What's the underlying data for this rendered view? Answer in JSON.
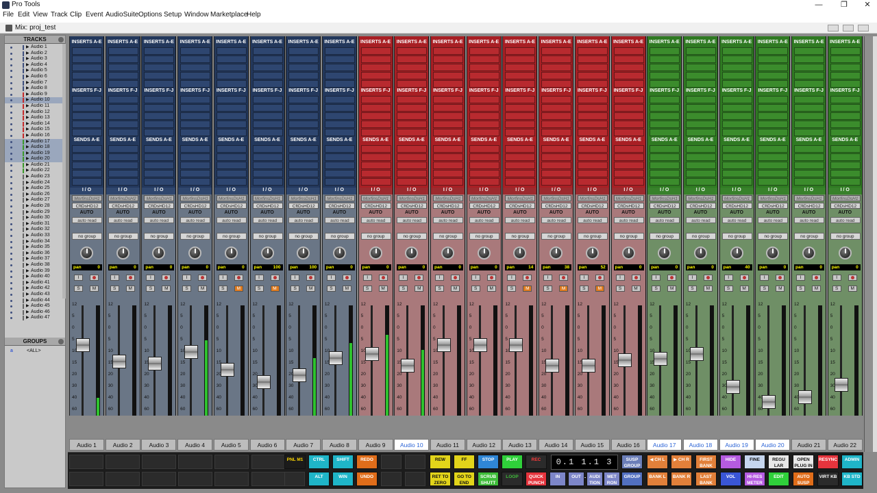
{
  "window": {
    "app_title": "Pro Tools",
    "minimize": "—",
    "restore": "❐",
    "close": "✕"
  },
  "menu": [
    "File",
    "Edit",
    "View",
    "Track",
    "Clip",
    "Event",
    "AudioSuite",
    "Options",
    "Setup",
    "Window",
    "Marketplace",
    "Help"
  ],
  "doc": {
    "title": "Mix: proj_test"
  },
  "tracks_pane": {
    "title": "TRACKS",
    "items": [
      "Audio 1",
      "Audio 2",
      "Audio 3",
      "Audio 4",
      "Audio 5",
      "Audio 6",
      "Audio 7",
      "Audio 8",
      "Audio 9",
      "Audio 10",
      "Audio 11",
      "Audio 12",
      "Audio 13",
      "Audio 14",
      "Audio 15",
      "Audio 16",
      "Audio 17",
      "Audio 18",
      "Audio 19",
      "Audio 20",
      "Audio 21",
      "Audio 22",
      "Audio 23",
      "Audio 24",
      "Audio 25",
      "Audio 26",
      "Audio 27",
      "Audio 28",
      "Audio 29",
      "Audio 30",
      "Audio 31",
      "Audio 32",
      "Audio 33",
      "Audio 34",
      "Audio 35",
      "Audio 36",
      "Audio 37",
      "Audio 38",
      "Audio 39",
      "Audio 40",
      "Audio 41",
      "Audio 42",
      "Audio 43",
      "Audio 44",
      "Audio 45",
      "Audio 46",
      "Audio 47"
    ],
    "selected": [
      10,
      17,
      18,
      19,
      20
    ]
  },
  "groups_pane": {
    "title": "GROUPS",
    "id": "a",
    "all": "<ALL>"
  },
  "strip_labels": {
    "inserts_ae": "INSERTS A-E",
    "inserts_fj": "INSERTS F-J",
    "sends": "SENDS A-E",
    "io": "I / O",
    "auto": "AUTO",
    "auto_mode": "auto read",
    "group": "no group",
    "pan": "pan",
    "solo": "S",
    "mute": "M",
    "input": "I",
    "link": "L"
  },
  "channels": [
    {
      "name": "Audio 1",
      "color": "blue",
      "in1": "MorfinsDsH1",
      "in2": "CftDsHD12",
      "pan": "0",
      "vol": "0.0",
      "vnum": "",
      "mute_on": false,
      "fader": 0.66,
      "meter": 0.2,
      "name_hi": false
    },
    {
      "name": "Audio 2",
      "color": "blue",
      "in1": "MorfinsDsH2",
      "in2": "CftDsHD12",
      "pan": "0",
      "vol": "-6.9",
      "vnum": "",
      "mute_on": false,
      "fader": 0.52,
      "meter": 0,
      "name_hi": false
    },
    {
      "name": "Audio 3",
      "color": "blue",
      "in1": "MorfinsDsH1",
      "in2": "CftDsHD12",
      "pan": "0",
      "vol": "-7.9",
      "vnum": "",
      "mute_on": false,
      "fader": 0.5,
      "meter": 0,
      "name_hi": false
    },
    {
      "name": "Audio 4",
      "color": "blue",
      "in1": "MorfinsDsH1",
      "in2": "CftDsHD12",
      "pan": "0",
      "vol": "-2.9",
      "vnum": "1",
      "mute_on": false,
      "fader": 0.6,
      "meter": 0.7,
      "name_hi": false
    },
    {
      "name": "Audio 5",
      "color": "blue",
      "in1": "MorfinsDsH1",
      "in2": "CftDsHD12",
      "pan": "0",
      "vol": "-10.6",
      "vnum": "2",
      "mute_on": true,
      "fader": 0.45,
      "meter": 0,
      "name_hi": false
    },
    {
      "name": "Audio 6",
      "color": "blue",
      "in1": "MorfinsDsH1",
      "in2": "CftDsHD12",
      "pan": "100",
      "vol": "-15.5",
      "vnum": "3",
      "mute_on": true,
      "fader": 0.34,
      "meter": 0,
      "name_hi": false
    },
    {
      "name": "Audio 7",
      "color": "blue",
      "in1": "MorfinsDsH1",
      "in2": "CftDsHD12",
      "pan": "100",
      "vol": "-12.2",
      "vnum": "4",
      "mute_on": false,
      "fader": 0.4,
      "meter": 0.55,
      "name_hi": false
    },
    {
      "name": "Audio 8",
      "color": "blue",
      "in1": "MorfinsDsH1",
      "in2": "CftDsHD12",
      "pan": "0",
      "vol": "-5.2",
      "vnum": "5",
      "mute_on": false,
      "fader": 0.55,
      "meter": 0.68,
      "name_hi": false
    },
    {
      "name": "Audio 9",
      "color": "red",
      "in1": "MorfinsDsH1",
      "in2": "CftDsHD12",
      "pan": "0",
      "vol": "-3.1",
      "vnum": "6",
      "mute_on": false,
      "fader": 0.58,
      "meter": 0.75,
      "name_hi": false
    },
    {
      "name": "Audio 10",
      "color": "red",
      "in1": "MorfinsDsH1",
      "in2": "CftDsHD12",
      "pan": "0",
      "vol": "-8.8",
      "vnum": "7",
      "mute_on": false,
      "fader": 0.48,
      "meter": 0.62,
      "name_hi": true
    },
    {
      "name": "Audio 11",
      "color": "red",
      "in1": "MorfinsDsH1",
      "in2": "CftDsHD12",
      "pan": "0",
      "vol": "0.0",
      "vnum": "8",
      "mute_on": false,
      "fader": 0.66,
      "meter": 0,
      "name_hi": false
    },
    {
      "name": "Audio 12",
      "color": "red",
      "in1": "MorfinsDsH1",
      "in2": "CftDsHD12",
      "pan": "0",
      "vol": "0.0",
      "vnum": "",
      "mute_on": false,
      "fader": 0.66,
      "meter": 0,
      "name_hi": false
    },
    {
      "name": "Audio 13",
      "color": "red",
      "in1": "MorfinsDsH1",
      "in2": "CftDsHD12",
      "pan": "14",
      "vol": "0.0",
      "vnum": "",
      "mute_on": true,
      "fader": 0.66,
      "meter": 0,
      "name_hi": false
    },
    {
      "name": "Audio 14",
      "color": "red",
      "in1": "MorfinsDsH1",
      "in2": "CftDsHD12",
      "pan": "38",
      "vol": "-8.3",
      "vnum": "",
      "mute_on": true,
      "fader": 0.48,
      "meter": 0,
      "name_hi": false
    },
    {
      "name": "Audio 15",
      "color": "red",
      "in1": "MorfinsDsH1",
      "in2": "CftDsHD12",
      "pan": "52",
      "vol": "-8.1",
      "vnum": "",
      "mute_on": true,
      "fader": 0.48,
      "meter": 0,
      "name_hi": false
    },
    {
      "name": "Audio 16",
      "color": "red",
      "in1": "MorfinsDsH1",
      "in2": "CftDsHD12",
      "pan": "0",
      "vol": "-6.3",
      "vnum": "",
      "mute_on": false,
      "fader": 0.53,
      "meter": 0,
      "name_hi": false
    },
    {
      "name": "Audio 17",
      "color": "green",
      "in1": "MorfinsDsH1",
      "in2": "CftDsHD12",
      "pan": "0",
      "vol": "-5.5",
      "vnum": "",
      "mute_on": false,
      "fader": 0.54,
      "meter": 0,
      "name_hi": true
    },
    {
      "name": "Audio 18",
      "color": "green",
      "in1": "MorfinsDsH1",
      "in2": "CftDsHD12",
      "pan": "0",
      "vol": "-3.1",
      "vnum": "",
      "mute_on": false,
      "fader": 0.58,
      "meter": 0,
      "name_hi": true
    },
    {
      "name": "Audio 19",
      "color": "green",
      "in1": "MorfinsDsH1",
      "in2": "CftDsHD12",
      "pan": "40",
      "vol": "-17.1",
      "vnum": "",
      "mute_on": false,
      "fader": 0.3,
      "meter": 0,
      "name_hi": true
    },
    {
      "name": "Audio 20",
      "color": "green",
      "in1": "MorfinsDsH1",
      "in2": "CftDsHD12",
      "pan": "0",
      "vol": "-25.9",
      "vnum": "",
      "mute_on": false,
      "fader": 0.17,
      "meter": 0,
      "name_hi": true
    },
    {
      "name": "Audio 21",
      "color": "green",
      "in1": "MorfinsDsH1",
      "in2": "CftDsHD12",
      "pan": "0",
      "vol": "-22.8",
      "vnum": "",
      "mute_on": false,
      "fader": 0.21,
      "meter": 0,
      "name_hi": false
    },
    {
      "name": "Audio 22",
      "color": "green",
      "in1": "MorfinsDsH1",
      "in2": "CftDsHD12",
      "pan": "0",
      "vol": "-16.2",
      "vnum": "",
      "mute_on": false,
      "fader": 0.32,
      "meter": 0,
      "name_hi": false
    }
  ],
  "scale_ticks": [
    "12",
    "5",
    "0",
    "5",
    "10",
    "15",
    "20",
    "30",
    "40",
    "60",
    "∞"
  ],
  "counter": "0.1 1.1 3 1",
  "transport": [
    {
      "id": "pnl",
      "label": "PNL M1",
      "bg": "#1b1b1b",
      "fg": "#ffd800"
    },
    {
      "id": "ctrl",
      "label": "CTRL",
      "bg": "#1fb5c8",
      "fg": "#ffffff"
    },
    {
      "id": "shift",
      "label": "SHIFT",
      "bg": "#1fb5c8",
      "fg": "#ffffff"
    },
    {
      "id": "redo",
      "label": "REDO",
      "bg": "#e06d1a",
      "fg": "#ffffff"
    },
    {
      "id": "alt",
      "label": "ALT",
      "bg": "#1fb5c8",
      "fg": "#ffffff"
    },
    {
      "id": "win",
      "label": "WIN",
      "bg": "#1fb5c8",
      "fg": "#ffffff"
    },
    {
      "id": "undo",
      "label": "UNDO",
      "bg": "#e06d1a",
      "fg": "#ffffff"
    },
    {
      "id": "rew",
      "label": "REW",
      "bg": "#e2d41a",
      "fg": "#111111"
    },
    {
      "id": "ff",
      "label": "FF",
      "bg": "#e2d41a",
      "fg": "#111111"
    },
    {
      "id": "stop",
      "label": "STOP",
      "bg": "#2f86d6",
      "fg": "#ffffff"
    },
    {
      "id": "play",
      "label": "PLAY",
      "bg": "#2fd03a",
      "fg": "#ffffff"
    },
    {
      "id": "rec",
      "label": "REC",
      "bg": "#2b2b2b",
      "fg": "#ff3b3b"
    },
    {
      "id": "rettozero",
      "label": "RET TO ZERO",
      "bg": "#e2d41a",
      "fg": "#111111"
    },
    {
      "id": "gotoend",
      "label": "GO TO END",
      "bg": "#e2d41a",
      "fg": "#111111"
    },
    {
      "id": "scrub",
      "label": "SCRUB SHUTT",
      "bg": "#3fbd3a",
      "fg": "#ffffff"
    },
    {
      "id": "loop",
      "label": "LOOP",
      "bg": "#2b2b2b",
      "fg": "#3fbd3a"
    },
    {
      "id": "qpunch",
      "label": "QUICK PUNCH",
      "bg": "#e5343d",
      "fg": "#ffffff"
    },
    {
      "id": "suspgroup",
      "label": "SUSP GROUP",
      "bg": "#6b7eb8",
      "fg": "#ffffff"
    },
    {
      "id": "group",
      "label": "GROUP",
      "bg": "#5270c0",
      "fg": "#ffffff"
    },
    {
      "id": "in",
      "label": "IN",
      "bg": "#7d86c8",
      "fg": "#ffffff"
    },
    {
      "id": "out",
      "label": "OUT",
      "bg": "#7d86c8",
      "fg": "#ffffff"
    },
    {
      "id": "audition",
      "label": "AUDI TION",
      "bg": "#7d86c8",
      "fg": "#ffffff"
    },
    {
      "id": "metron",
      "label": "MET RON",
      "bg": "#7d86c8",
      "fg": "#ffffff"
    },
    {
      "id": "chl",
      "label": "◀ CH L",
      "bg": "#e2803a",
      "fg": "#ffffff"
    },
    {
      "id": "chr",
      "label": "▶ CH R",
      "bg": "#e2803a",
      "fg": "#ffffff"
    },
    {
      "id": "firstbank",
      "label": "FIRST BANK",
      "bg": "#e2803a",
      "fg": "#ffffff"
    },
    {
      "id": "bankl",
      "label": "BANK L",
      "bg": "#e2803a",
      "fg": "#ffffff"
    },
    {
      "id": "bankr",
      "label": "BANK R",
      "bg": "#e2803a",
      "fg": "#ffffff"
    },
    {
      "id": "lastbank",
      "label": "LAST BANK",
      "bg": "#e2803a",
      "fg": "#ffffff"
    },
    {
      "id": "hide",
      "label": "HIDE",
      "bg": "#b55be0",
      "fg": "#ffffff"
    },
    {
      "id": "vol",
      "label": "VOL",
      "bg": "#3a56d6",
      "fg": "#ffffff"
    },
    {
      "id": "fine",
      "label": "FINE",
      "bg": "#c6d6ee",
      "fg": "#111111"
    },
    {
      "id": "hires",
      "label": "HI-RES METER",
      "bg": "#b55be0",
      "fg": "#ffffff"
    },
    {
      "id": "regular",
      "label": "REGU LAR",
      "bg": "#e8e8e8",
      "fg": "#111111"
    },
    {
      "id": "edit",
      "label": "EDIT",
      "bg": "#2fd03a",
      "fg": "#ffffff"
    },
    {
      "id": "openplugin",
      "label": "OPEN PLUG IN",
      "bg": "#e8e8e8",
      "fg": "#111111"
    },
    {
      "id": "autosusp",
      "label": "AUTO SUSP",
      "bg": "#e06d1a",
      "fg": "#ffffff"
    },
    {
      "id": "resync",
      "label": "RESYNC",
      "bg": "#e5343d",
      "fg": "#ffffff"
    },
    {
      "id": "virtkb",
      "label": "VIRT KB",
      "bg": "#2b2b2b",
      "fg": "#ffffff"
    },
    {
      "id": "admin",
      "label": "ADMIN",
      "bg": "#1fb5c8",
      "fg": "#ffffff"
    },
    {
      "id": "kbstd",
      "label": "KB STD",
      "bg": "#1fb5c8",
      "fg": "#ffffff"
    }
  ]
}
